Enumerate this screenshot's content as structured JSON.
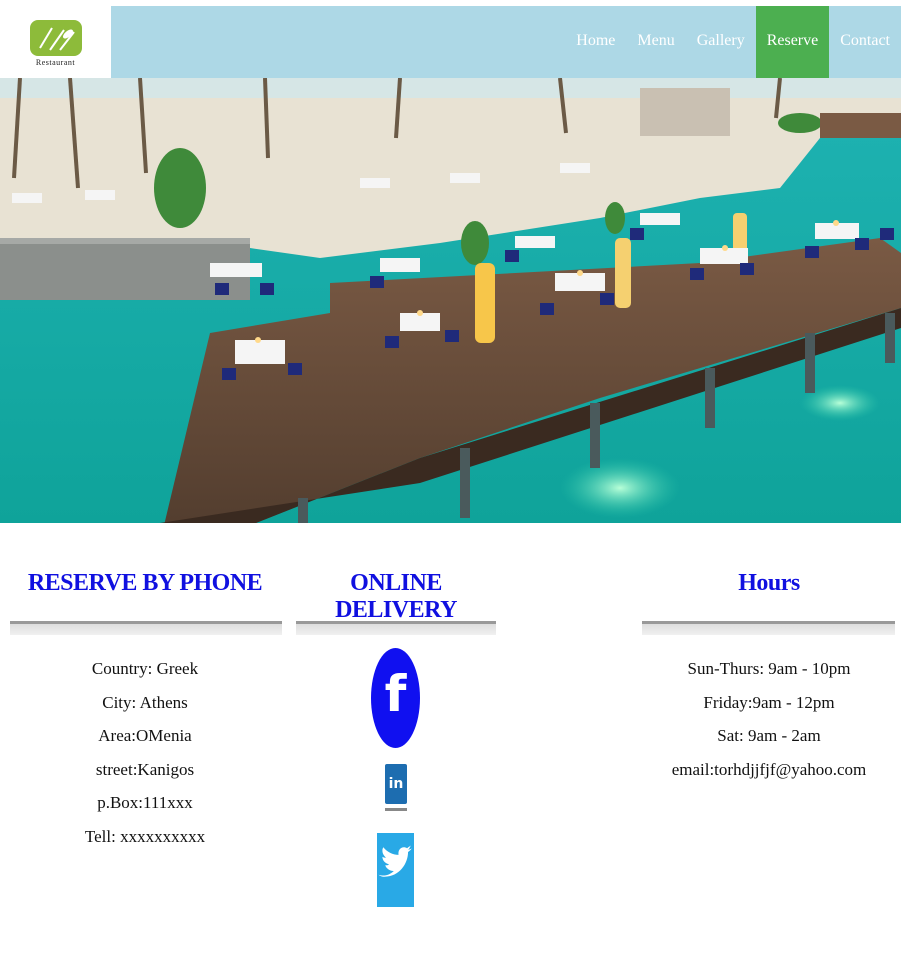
{
  "logo": {
    "text": "Restaurant"
  },
  "nav": {
    "items": [
      {
        "label": "Home",
        "active": false
      },
      {
        "label": "Menu",
        "active": false
      },
      {
        "label": "Gallery",
        "active": false
      },
      {
        "label": "Reserve",
        "active": true
      },
      {
        "label": "Contact",
        "active": false
      }
    ]
  },
  "reserve": {
    "title": "RESERVE BY PHONE",
    "lines": [
      "Country: Greek",
      "City: Athens",
      "Area:OMenia",
      "street:Kanigos",
      "p.Box:111xxx",
      "Tell: xxxxxxxxxx"
    ]
  },
  "delivery": {
    "title": "ONLINE DELIVERY",
    "icons": [
      "facebook-icon",
      "linkedin-icon",
      "twitter-icon"
    ]
  },
  "hours": {
    "title": "Hours",
    "lines": [
      "Sun-Thurs: 9am - 10pm",
      "Friday:9am - 12pm",
      "Sat: 9am - 2am",
      "email:torhdjjfjf@yahoo.com"
    ]
  },
  "colors": {
    "header_bg": "#add8e6",
    "active_nav": "#4caf50",
    "title_blue": "#1010e0"
  }
}
